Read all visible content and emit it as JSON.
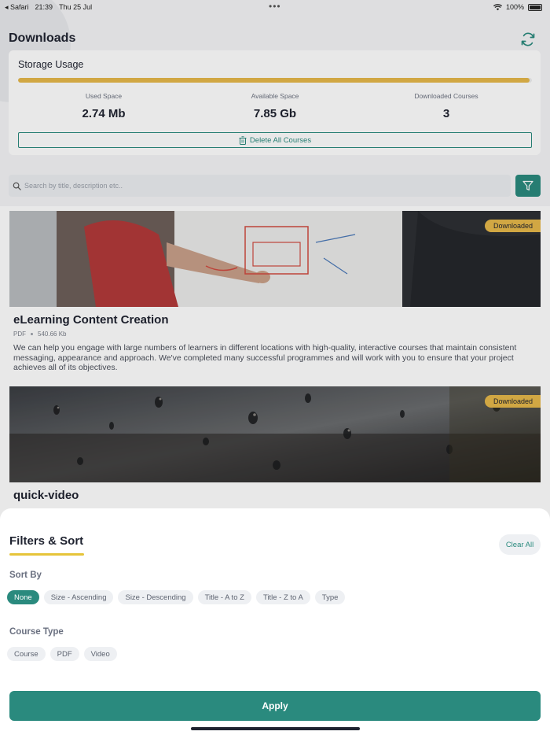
{
  "status_bar": {
    "back_app": "◂ Safari",
    "time": "21:39",
    "date": "Thu 25 Jul",
    "battery": "100%"
  },
  "page": {
    "title": "Downloads"
  },
  "storage": {
    "title": "Storage Usage",
    "used_fraction": 0.995,
    "stats": [
      {
        "label": "Used Space",
        "value": "2.74 Mb"
      },
      {
        "label": "Available Space",
        "value": "7.85 Gb"
      },
      {
        "label": "Downloaded Courses",
        "value": "3"
      }
    ],
    "delete_label": "Delete All Courses"
  },
  "search": {
    "placeholder": "Search by title, description etc.."
  },
  "courses": [
    {
      "badge": "Downloaded",
      "title": "eLearning Content Creation",
      "type": "PDF",
      "size": "540.66 Kb",
      "description": "We can help you engage with large numbers of learners in different locations with high-quality, interactive courses that maintain consistent messaging, appearance and approach. We've completed many successful programmes and will work with you to ensure that your project achieves all of its objectives."
    },
    {
      "badge": "Downloaded",
      "title": "quick-video"
    }
  ],
  "sheet": {
    "title": "Filters & Sort",
    "clear_label": "Clear All",
    "sort_label": "Sort By",
    "sort_options": [
      "None",
      "Size - Ascending",
      "Size - Descending",
      "Title - A to Z",
      "Title - Z to A",
      "Type"
    ],
    "sort_selected": "None",
    "type_label": "Course Type",
    "type_options": [
      "Course",
      "PDF",
      "Video"
    ],
    "apply_label": "Apply"
  },
  "colors": {
    "accent": "#2a8a7e",
    "progress": "#e6b84a",
    "badge": "#e6b84a",
    "underline": "#e6c43a"
  }
}
